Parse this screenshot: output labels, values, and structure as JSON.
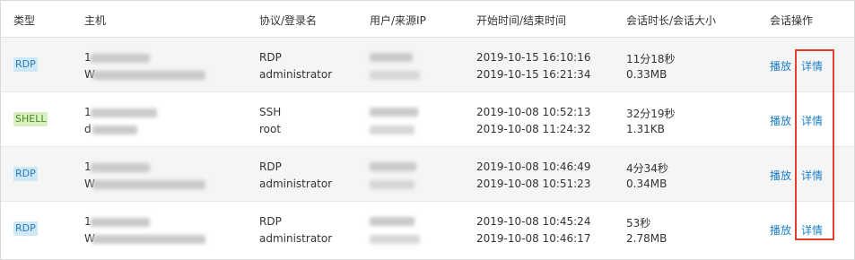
{
  "header": {
    "type": "类型",
    "host": "主机",
    "protocol_login": "协议/登录名",
    "user_ip": "用户/来源IP",
    "time": "开始时间/结束时间",
    "duration_size": "会话时长/会话大小",
    "actions": "会话操作"
  },
  "rows": [
    {
      "type": "RDP",
      "host_prefix": "1",
      "host_prefix2": "W",
      "protocol": "RDP",
      "login": "administrator",
      "start": "2019-10-15 16:10:16",
      "end": "2019-10-15 16:21:34",
      "duration": "11分18秒",
      "size": "0.33MB",
      "play": "播放",
      "detail": "详情"
    },
    {
      "type": "SHELL",
      "host_prefix": "1",
      "host_prefix2": "d",
      "protocol": "SSH",
      "login": "root",
      "start": "2019-10-08 10:52:13",
      "end": "2019-10-08 11:24:32",
      "duration": "32分19秒",
      "size": "1.31KB",
      "play": "播放",
      "detail": "详情"
    },
    {
      "type": "RDP",
      "host_prefix": "1",
      "host_prefix2": "W",
      "protocol": "RDP",
      "login": "administrator",
      "start": "2019-10-08 10:46:49",
      "end": "2019-10-08 10:51:23",
      "duration": "4分34秒",
      "size": "0.34MB",
      "play": "播放",
      "detail": "详情"
    },
    {
      "type": "RDP",
      "host_prefix": "1",
      "host_prefix2": "W",
      "protocol": "RDP",
      "login": "administrator",
      "start": "2019-10-08 10:45:24",
      "end": "2019-10-08 10:46:17",
      "duration": "53秒",
      "size": "2.78MB",
      "play": "播放",
      "detail": "详情"
    }
  ],
  "colors": {
    "link": "#1d7fc6",
    "highlight_border": "#e53e2e",
    "rdp_tag_bg": "#cfe8f7",
    "shell_tag_bg": "#d9f0c3"
  }
}
